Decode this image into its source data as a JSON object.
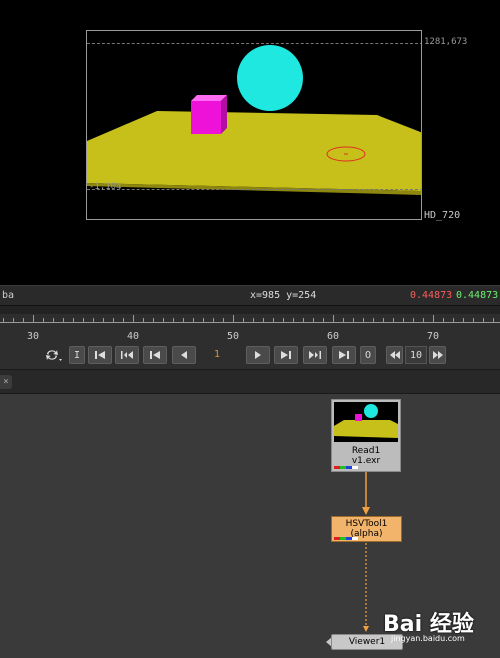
{
  "viewer": {
    "resolution_top": "1281,673",
    "resolution_bottom": "-1,104",
    "format": "HD_720"
  },
  "infobar": {
    "channel": "ba",
    "coords": "x=985 y=254",
    "value_r": "0.44873",
    "value_g": "0.44873"
  },
  "timeline": {
    "labels": [
      "30",
      "40",
      "50",
      "60",
      "70"
    ]
  },
  "transport": {
    "frame": "1",
    "step": "10",
    "btn_i": "I",
    "btn_o": "O"
  },
  "nodes": {
    "read": {
      "label": "Read1",
      "file": "v1.exr"
    },
    "hsv": {
      "label": "HSVTool1",
      "sub": "(alpha)"
    },
    "viewer": {
      "label": "Viewer1"
    }
  },
  "watermark": {
    "logo": "Bai 经验",
    "url": "jingyan.baidu.com"
  },
  "colors": {
    "ground": "#c8c01a",
    "sphere": "#1fe8e0",
    "cube": "#ee12d8",
    "ellipse": "#e03020",
    "wire_read": "#f0a040",
    "node_hsv": "#f2b36b",
    "value_r": "#ff5b5b",
    "value_g": "#6df06d"
  }
}
